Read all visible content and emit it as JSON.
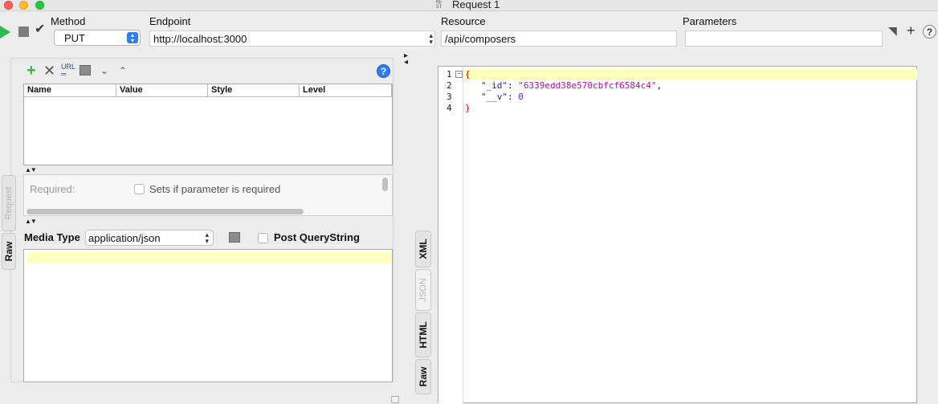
{
  "window": {
    "title": "Request 1",
    "title_icon": "RE ST"
  },
  "toolbar": {
    "method_label": "Method",
    "method_value": "PUT",
    "endpoint_label": "Endpoint",
    "endpoint_value": "http://localhost:3000",
    "resource_label": "Resource",
    "resource_value": "/api/composers",
    "parameters_label": "Parameters",
    "parameters_value": ""
  },
  "params": {
    "columns": [
      "Name",
      "Value",
      "Style",
      "Level"
    ],
    "required_label": "Required:",
    "required_hint": "Sets if parameter is required"
  },
  "request": {
    "media_type_label": "Media Type",
    "media_type_value": "application/json",
    "post_querystring_label": "Post QueryString",
    "side_tabs": {
      "request": "Request",
      "raw": "Raw"
    }
  },
  "response": {
    "side_tabs": [
      "XML",
      "JSON",
      "HTML",
      "Raw"
    ],
    "lines": [
      {
        "n": "1",
        "tokens": [
          {
            "t": "{",
            "c": "brace"
          }
        ]
      },
      {
        "n": "2",
        "tokens": [
          {
            "t": "   ",
            "c": ""
          },
          {
            "t": "\"_id\"",
            "c": "key"
          },
          {
            "t": ": ",
            "c": ""
          },
          {
            "t": "\"6339edd38e570cbfcf6584c4\"",
            "c": "str"
          },
          {
            "t": ",",
            "c": ""
          }
        ]
      },
      {
        "n": "3",
        "tokens": [
          {
            "t": "   ",
            "c": ""
          },
          {
            "t": "\"__v\"",
            "c": "key"
          },
          {
            "t": ": ",
            "c": ""
          },
          {
            "t": "0",
            "c": "num"
          }
        ]
      },
      {
        "n": "4",
        "tokens": [
          {
            "t": "}",
            "c": "brace"
          }
        ]
      }
    ]
  },
  "colors": {
    "run": "#2db84d",
    "accent": "#2f7cf6",
    "highlight": "#ffffbe"
  }
}
